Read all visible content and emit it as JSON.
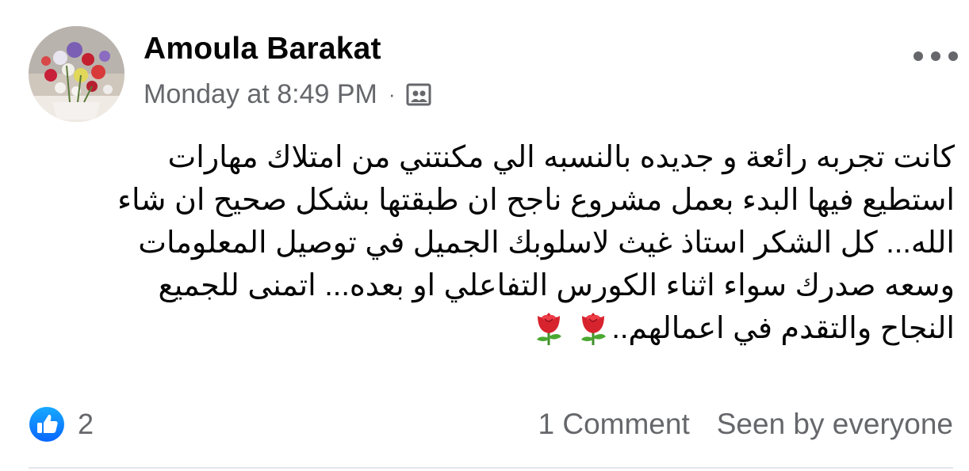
{
  "post": {
    "author": "Amoula Barakat",
    "timestamp": "Monday at 8:49 PM",
    "separator": "·",
    "audience_icon": "audience-icon",
    "more_icon": "more-options-icon",
    "text_lines": [
      "كانت تجربه رائعة و جديده  بالنسبه الي مكنتني  من امتلاك مهارات",
      "استطيع فيها البدء بعمل مشروع ناجح ان طبقتها بشكل صحيح ان شاء",
      "الله... كل الشكر  استاذ غيث  لاسلوبك الجميل في توصيل المعلومات",
      "وسعه صدرك سواء اثناء الكورس التفاعلي او بعده... اتمنى للجميع",
      "النجاح والتقدم في اعمالهم.."
    ],
    "emoji": [
      "rose-emoji",
      "rose-emoji"
    ]
  },
  "footer": {
    "like_icon": "like-icon",
    "like_count": "2",
    "comments": "1 Comment",
    "seen": "Seen by everyone"
  },
  "colors": {
    "primary_text": "#050505",
    "secondary_text": "#65676b",
    "like_blue": "#1877f2",
    "divider": "#e4e6eb"
  }
}
